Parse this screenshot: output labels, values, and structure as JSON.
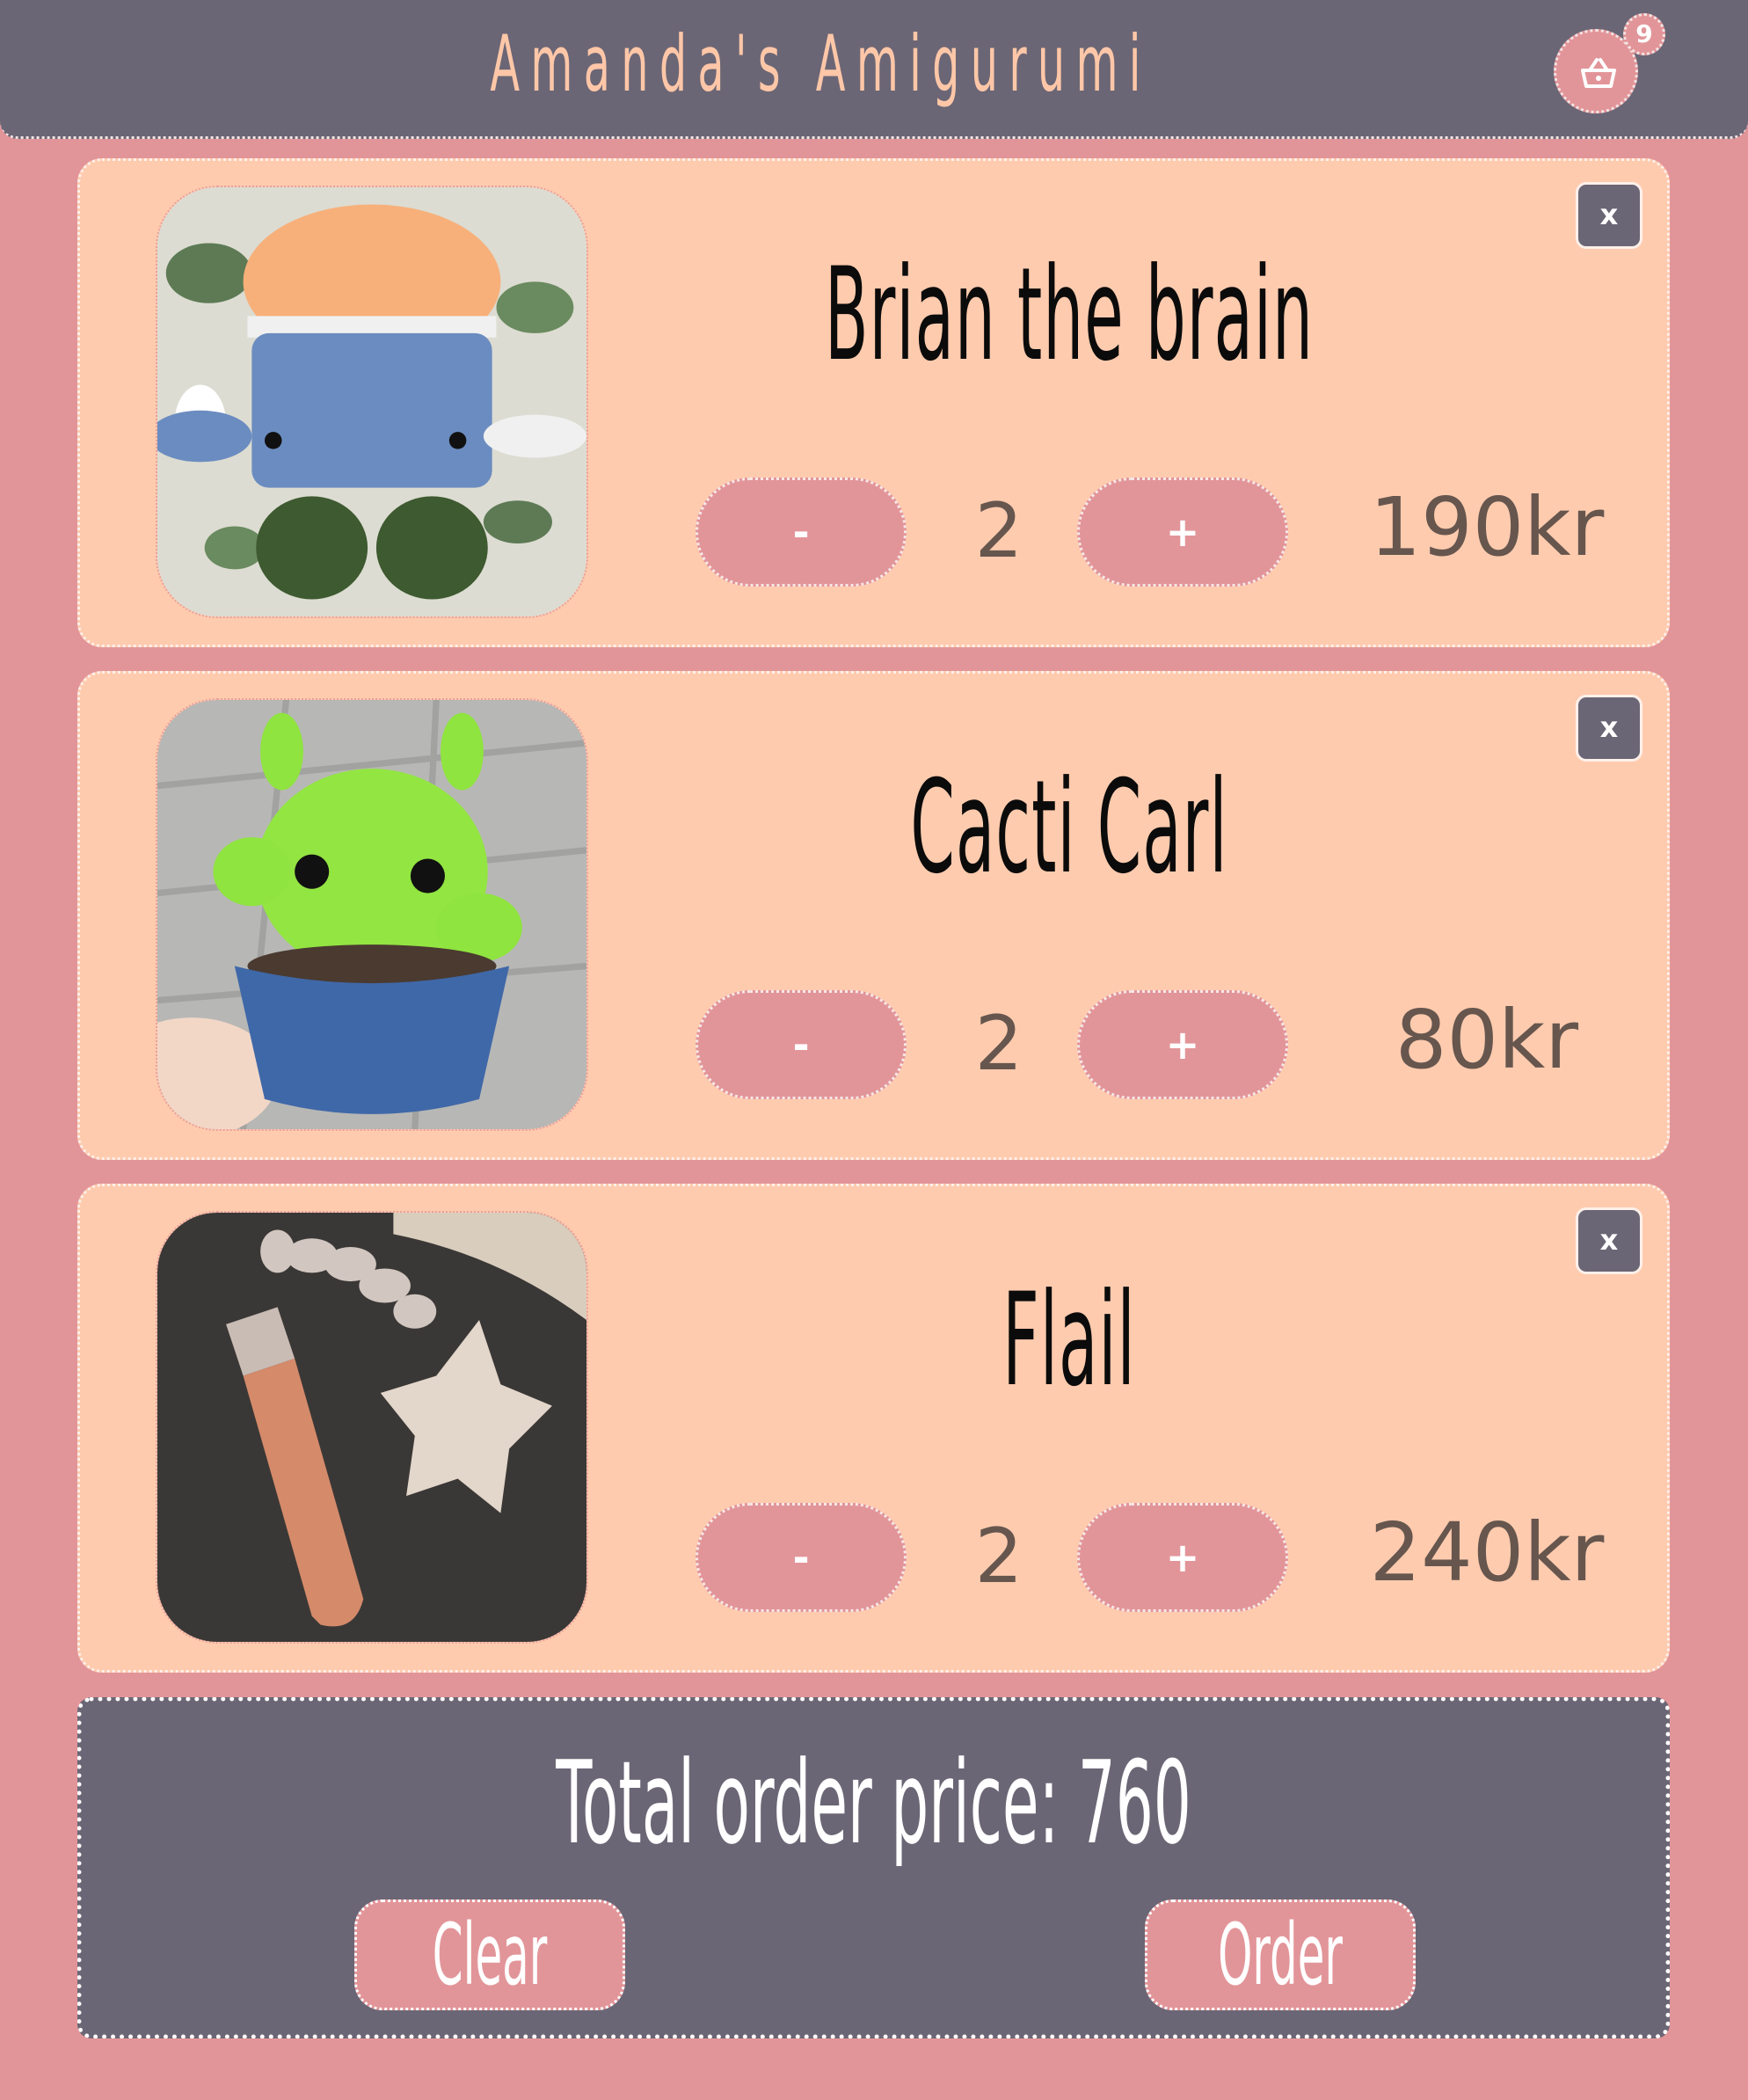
{
  "header": {
    "title": "Amanda's Amigurumi",
    "cart_count": "9",
    "cart_icon": "basket-icon"
  },
  "items": [
    {
      "name": "Brian the brain",
      "quantity": "2",
      "price": "190kr",
      "minus_label": "-",
      "plus_label": "+",
      "remove_label": "x",
      "photo": "crochet-brain-photo"
    },
    {
      "name": "Cacti Carl",
      "quantity": "2",
      "price": "80kr",
      "minus_label": "-",
      "plus_label": "+",
      "remove_label": "x",
      "photo": "crochet-cactus-photo"
    },
    {
      "name": "Flail",
      "quantity": "2",
      "price": "240kr",
      "minus_label": "-",
      "plus_label": "+",
      "remove_label": "x",
      "photo": "crochet-flail-photo"
    }
  ],
  "summary": {
    "total_text": "Total order price: 760",
    "clear_label": "Clear",
    "order_label": "Order"
  },
  "colors": {
    "background": "#e29599",
    "header": "#6b6675",
    "card": "#ffcbae",
    "title_text": "#ffc7a8",
    "price_text": "#66564e"
  }
}
